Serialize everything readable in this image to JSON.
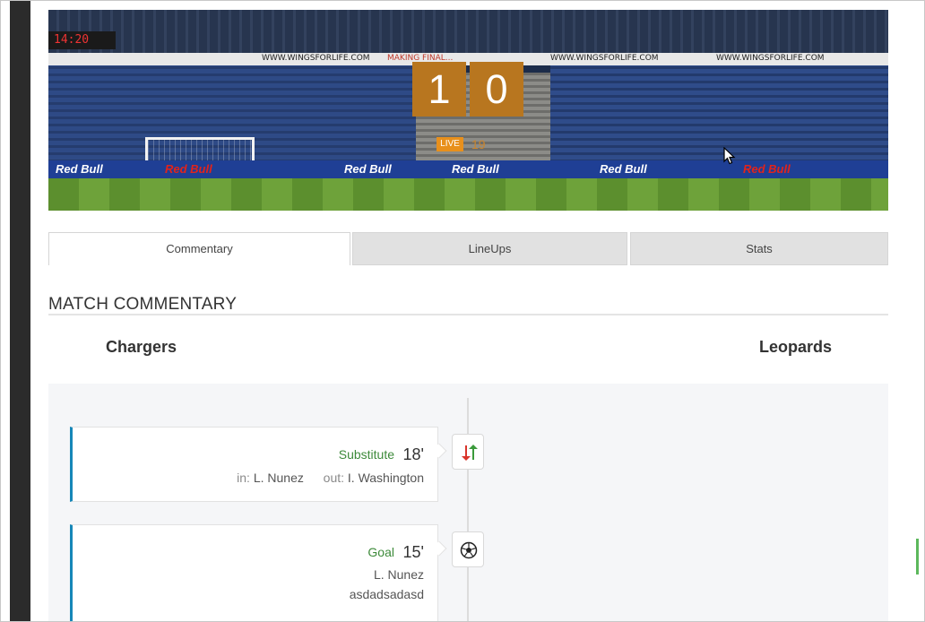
{
  "hero": {
    "ad_texts": [
      "WWW.WINGSFORLIFE.COM",
      "MAKING FINAL...",
      "WWW.WINGSFORLIFE.COM",
      "WWW.WINGSFORLIFE.COM"
    ],
    "board_texts": [
      "Red Bull",
      "Red Bull",
      "Red Bull",
      "Red Bull",
      "Red Bull",
      "Red Bull"
    ],
    "clock": "14:20"
  },
  "score": {
    "home": "1",
    "away": "0",
    "status_badge": "LIVE",
    "minute": "19"
  },
  "tabs": [
    {
      "label": "Commentary",
      "active": true
    },
    {
      "label": "LineUps",
      "active": false
    },
    {
      "label": "Stats",
      "active": false
    }
  ],
  "section_title": "MATCH COMMENTARY",
  "teams": {
    "home": "Chargers",
    "away": "Leopards"
  },
  "events": [
    {
      "type": "Substitute",
      "minute": "18'",
      "in_label": "in:",
      "in_player": "L. Nunez",
      "out_label": "out:",
      "out_player": "I. Washington",
      "icon": "substitution-icon"
    },
    {
      "type": "Goal",
      "minute": "15'",
      "player": "L. Nunez",
      "note": "asdadsadasd",
      "icon": "soccer-ball-icon"
    }
  ],
  "colors": {
    "score_box": "#b8761f",
    "live_badge": "#e8901c",
    "event_type": "#3d8a3a",
    "card_accent": "#1787b8"
  }
}
